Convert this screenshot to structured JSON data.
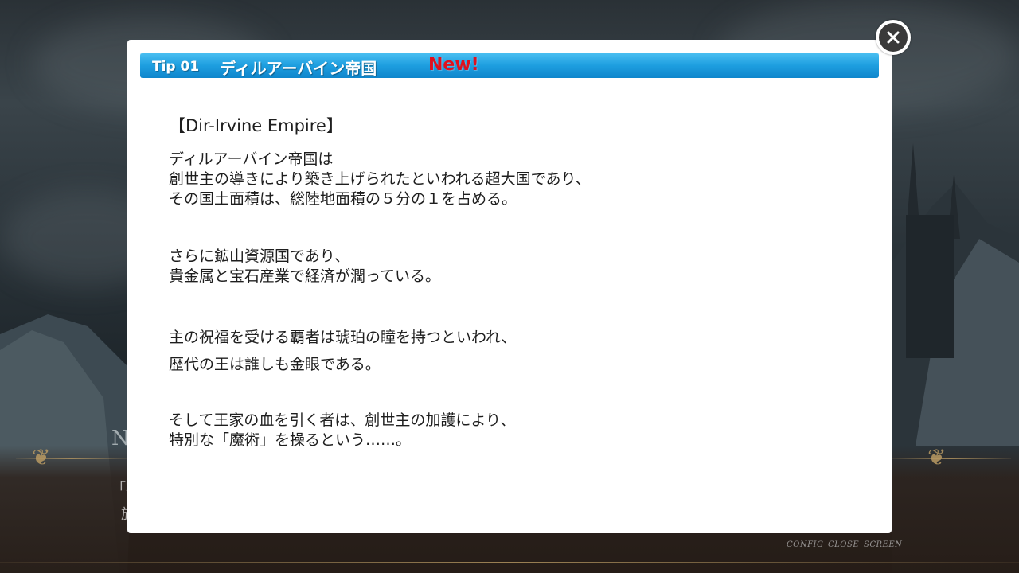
{
  "tip": {
    "number": "Tip 01",
    "title": "ディルアーバイン帝国",
    "badge": "New!"
  },
  "content": {
    "heading": "【Dir-Irvine Empire】",
    "paragraphs": [
      [
        "ディルアーバイン帝国は",
        "創世主の導きにより築き上げられたといわれる超大国であり、",
        "その国土面積は、総陸地面積の５分の１を占める。"
      ],
      [
        "さらに鉱山資源国であり、",
        "貴金属と宝石産業で経済が潤っている。"
      ],
      [
        "主の祝福を受ける覇者は琥珀の瞳を持つといわれ、",
        "歴代の王は誰しも金眼である。"
      ],
      [
        "そして王家の血を引く者は、創世主の加護により、",
        "特別な「魔術」を操るという……。"
      ]
    ]
  },
  "close_button": {
    "icon": "close-icon"
  },
  "background": {
    "speaker_initial": "N",
    "dialog_line1": "「婁",
    "dialog_line2": "旋",
    "menu": [
      "CONFIG",
      "CLOSE",
      "SCREEN"
    ]
  },
  "colors": {
    "title_bar": "#1e9fe0",
    "new_badge": "#e0101e",
    "panel": "#ffffff",
    "text": "#1e1e1e"
  }
}
